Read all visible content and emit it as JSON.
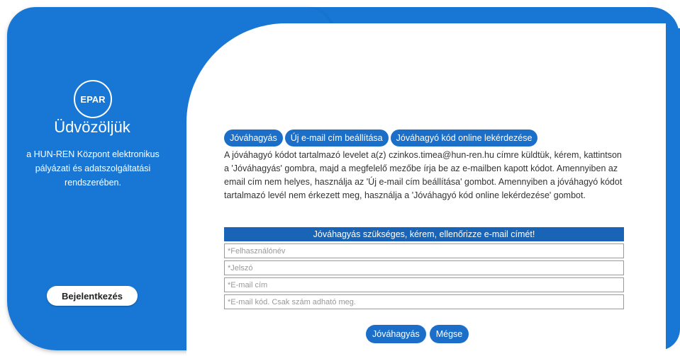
{
  "brand": {
    "logo_text": "EPAR",
    "welcome_title": "Üdvözöljük",
    "intro_text": "a HUN-REN Központ elektronikus pályázati és adatszolgáltatási rendszerében."
  },
  "sidebar": {
    "login_label": "Bejelentkezés"
  },
  "tabs": [
    {
      "label": "Jóváhagyás"
    },
    {
      "label": "Új e-mail cím beállítása"
    },
    {
      "label": "Jóváhagyó kód online lekérdezése"
    }
  ],
  "notice": "A jóváhagyó kódot tartalmazó levelet a(z) czinkos.timea@hun-ren.hu címre küldtük, kérem, kattintson a 'Jóváhagyás' gombra, majd a megfelelő mezőbe írja be az e-mailben kapott kódot. Amennyiben az email cím nem helyes, használja az 'Új e-mail cím beállítása' gombot. Amennyiben a jóváhagyó kódot tartalmazó levél nem érkezett meg, használja a 'Jóváhagyó kód online lekérdezése' gombot.",
  "alert": "Jóváhagyás szükséges, kérem, ellenőrizze e-mail címét!",
  "form": {
    "username_placeholder": "*Felhasználónév",
    "password_placeholder": "*Jelszó",
    "email_placeholder": "*E-mail cím",
    "code_placeholder": "*E-mail kód. Csak szám adható meg."
  },
  "actions": {
    "approve_label": "Jóváhagyás",
    "cancel_label": "Mégse"
  },
  "colors": {
    "primary": "#1877d4",
    "button": "#1b6fc9",
    "alert_bar": "#1a64b8"
  }
}
